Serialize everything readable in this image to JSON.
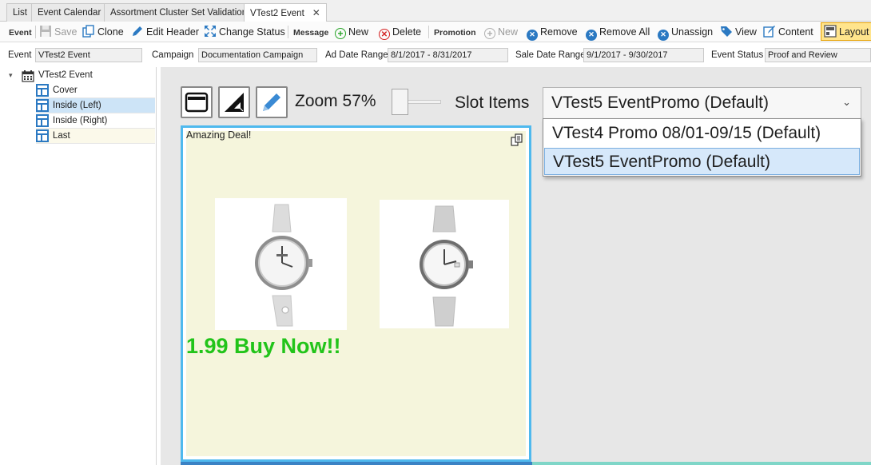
{
  "tabs": [
    {
      "label": "List"
    },
    {
      "label": "Event Calendar"
    },
    {
      "label": "Assortment Cluster Set Validation"
    },
    {
      "label": "VTest2 Event",
      "active": true,
      "close": "✕"
    }
  ],
  "toolbar": {
    "event_section": "Event",
    "save": "Save",
    "clone": "Clone",
    "edit_header": "Edit Header",
    "change_status": "Change Status",
    "message_section": "Message",
    "new_message": "New",
    "delete": "Delete",
    "promotion_section": "Promotion",
    "new_promotion": "New",
    "remove": "Remove",
    "remove_all": "Remove All",
    "unassign": "Unassign",
    "view": "View",
    "content": "Content",
    "layout": "Layout"
  },
  "fields": {
    "event_label": "Event",
    "event_value": "VTest2 Event",
    "campaign_label": "Campaign",
    "campaign_value": "Documentation Campaign",
    "ad_date_label": "Ad Date Range",
    "ad_date_value": "8/1/2017 - 8/31/2017",
    "sale_date_label": "Sale Date Range",
    "sale_date_value": "9/1/2017 - 9/30/2017",
    "status_label": "Event Status",
    "status_value": "Proof and Review"
  },
  "tree": {
    "root": "VTest2 Event",
    "children": [
      {
        "label": "Cover"
      },
      {
        "label": "Inside (Left)",
        "selected": true
      },
      {
        "label": "Inside (Right)"
      },
      {
        "label": "Last"
      }
    ]
  },
  "canvas_toolbar": {
    "zoom_label": "Zoom 57%",
    "slot_items_label": "Slot Items",
    "selected_slot_item": "VTest5 EventPromo (Default)",
    "options": [
      "VTest4 Promo 08/01-09/15 (Default)",
      "VTest5 EventPromo (Default)"
    ]
  },
  "page": {
    "heading": "Amazing Deal!",
    "price": "1.99 Buy Now!!"
  },
  "colors": {
    "accent": "#4fb9ee",
    "price": "#22c41a",
    "selection": "#cde4f7",
    "layout_button": "#ffe48c"
  }
}
